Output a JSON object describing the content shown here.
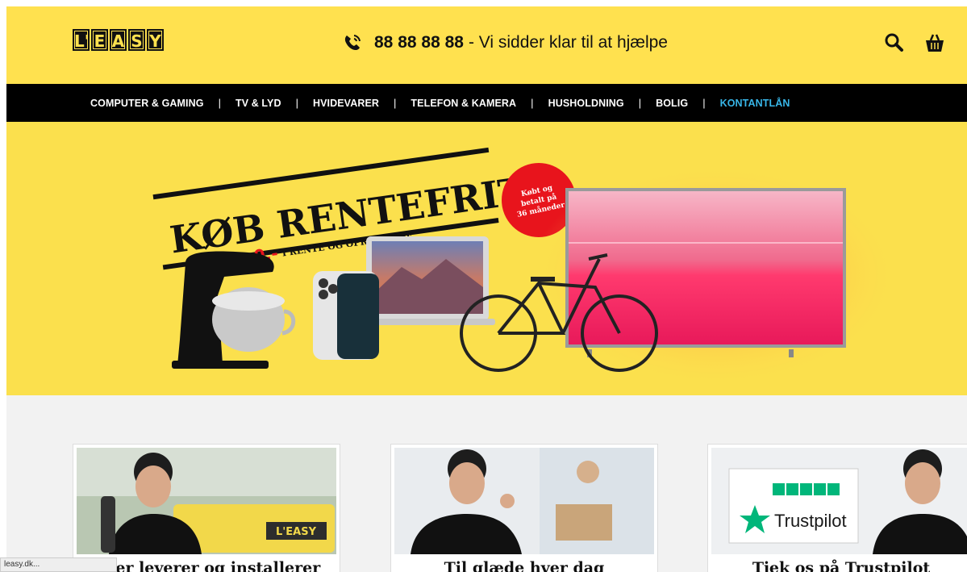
{
  "header": {
    "logo_letters": [
      "L'",
      "E",
      "A",
      "S",
      "Y"
    ],
    "phone_number": "88 88 88 88",
    "phone_text": "- Vi sidder klar til at hjælpe",
    "icons": [
      "phone-icon",
      "search-icon",
      "basket-icon"
    ]
  },
  "nav": {
    "items": [
      "COMPUTER & GAMING",
      "TV & LYD",
      "HVIDEVARER",
      "TELEFON & KAMERA",
      "HUSHOLDNING",
      "BOLIG",
      "KONTANTLÅN"
    ],
    "accent": "#38b6e8"
  },
  "hero": {
    "headline": "KØB RENTEFRIT",
    "price_prefix": "0,-",
    "subline": "I RENTE OG OPRETTELSE",
    "badge": "Købt og betalt på 36 måneder"
  },
  "cards": [
    {
      "title": "...ter leverer og installerer",
      "van_text": "L'EASY"
    },
    {
      "title": "Til glæde hver dag"
    },
    {
      "title": "Tjek os på Trustpilot",
      "trustpilot": "Trustpilot"
    }
  ],
  "status_bar": "leasy.dk...",
  "colors": {
    "brand_yellow": "#ffe14f",
    "nav_bg": "#000000",
    "badge_red": "#e8141c"
  }
}
